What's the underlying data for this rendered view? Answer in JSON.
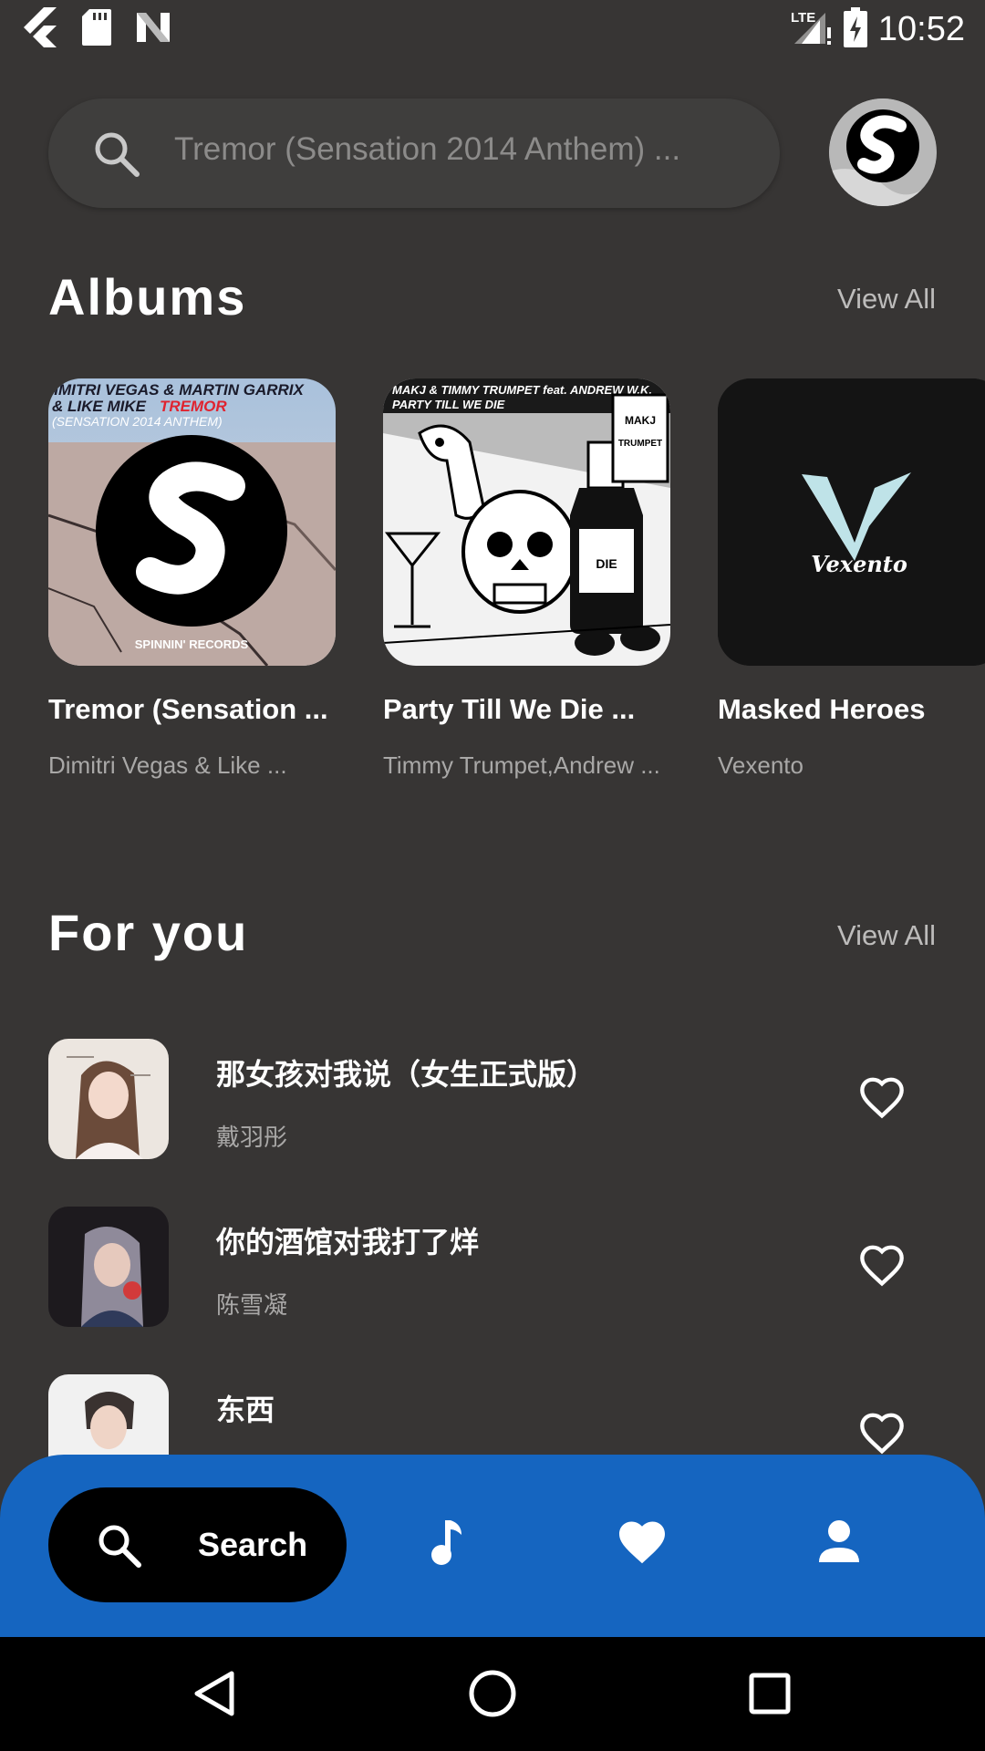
{
  "status_bar": {
    "time": "10:52",
    "network": "LTE",
    "left_icons": [
      "flutter-icon",
      "sd-card-icon",
      "n-icon"
    ],
    "right_icons": [
      "signal-icon",
      "battery-charging-icon"
    ]
  },
  "search": {
    "placeholder": "Tremor (Sensation 2014 Anthem) ..."
  },
  "albums_section": {
    "title": "Albums",
    "view_all": "View All",
    "items": [
      {
        "title": "Tremor (Sensation ...",
        "artist": "Dimitri Vegas & Like ...",
        "cover_text_1": "DIMITRI VEGAS & MARTIN GARRIX",
        "cover_text_2": "& LIKE MIKE",
        "cover_text_3": "TREMOR",
        "cover_text_4": "(SENSATION 2014 ANTHEM)",
        "cover_label": "SPINNIN' RECORDS"
      },
      {
        "title": "Party Till We Die ...",
        "artist": "Timmy Trumpet,Andrew ...",
        "cover_text_1": "MAKJ & TIMMY TRUMPET feat. ANDREW W.K.",
        "cover_text_2": "PARTY TILL WE DIE"
      },
      {
        "title": "Masked Heroes",
        "artist": "Vexento",
        "cover_text_1": "Vexento"
      }
    ]
  },
  "for_you_section": {
    "title": "For you",
    "view_all": "View All",
    "items": [
      {
        "title": "那女孩对我说（女生正式版）",
        "artist": "戴羽彤"
      },
      {
        "title": "你的酒馆对我打了烊",
        "artist": "陈雪凝"
      },
      {
        "title": "东西",
        "artist": ""
      }
    ]
  },
  "bottom_nav": {
    "active_label": "Search",
    "items": [
      "search-icon",
      "music-note-icon",
      "heart-icon",
      "person-icon"
    ]
  },
  "colors": {
    "background": "#373534",
    "search_bg": "#3f3e3d",
    "nav_bg": "#1565c0",
    "pill_bg": "#000000",
    "subtext": "#a9a8a7"
  }
}
